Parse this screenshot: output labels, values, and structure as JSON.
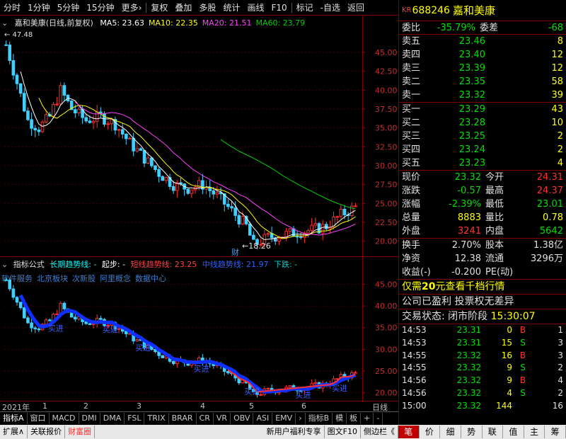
{
  "toolbar": {
    "items": [
      "分时",
      "1分钟",
      "5分钟",
      "15分钟",
      "更多›",
      "复权",
      "叠加",
      "多股",
      "统计",
      "画线",
      "F10",
      "标记",
      "-自选",
      "返回"
    ]
  },
  "main_chart": {
    "stock_label": "嘉和美康(日线,前复权)",
    "ma": [
      {
        "label": "MA5: 23.63",
        "color": "#ffffff"
      },
      {
        "label": "MA10: 22.35",
        "color": "#ffff00"
      },
      {
        "label": "MA20: 21.51",
        "color": "#ff40ff"
      },
      {
        "label": "MA60: 23.79",
        "color": "#00d000"
      }
    ],
    "high_marker": "47.48",
    "low_marker": "18.26",
    "event_marker": "财",
    "price_ticks": [
      "45.00",
      "42.50",
      "40.00",
      "37.50",
      "35.00",
      "32.50",
      "30.00",
      "27.50",
      "25.00",
      "22.50",
      "20.00"
    ],
    "price_range": [
      18.0,
      48.0
    ]
  },
  "sub_chart": {
    "formula_label": "指标公式",
    "long_trend": "长期趋势线: -",
    "start_label": "起步: -",
    "short_trend": "短线趋势线: 23.25",
    "mid_trend": "中线趋势线: 21.97",
    "down_label": "下跌: -",
    "concepts": [
      "软件服务",
      "北京板块",
      "次新股",
      "阿里概念",
      "数据中心"
    ],
    "buy_signal": "买进",
    "price_ticks": [
      "45.00",
      "40.00",
      "35.00",
      "30.00",
      "25.00",
      "20.00"
    ],
    "price_range": [
      18.0,
      48.0
    ]
  },
  "date_axis": {
    "labels": [
      "2021年",
      "1",
      "2",
      "3",
      "4",
      "5",
      "6"
    ],
    "period_label": "日线"
  },
  "indicator_tabs": [
    "指标A",
    "窗口",
    "MACD",
    "DMI",
    "DMA",
    "FSL",
    "TRIX",
    "BRAR",
    "CR",
    "VR",
    "OBV",
    "ASI",
    "EMV",
    "›",
    "指标B",
    "模",
    "板",
    "+",
    "-"
  ],
  "status_bar": {
    "left": [
      "扩展∧",
      "关联报价",
      "财富圈"
    ],
    "right": [
      "新用户福利专享",
      "图文F10",
      "侧边栏《"
    ]
  },
  "quote": {
    "kr": "KR",
    "code": "688246",
    "name": "嘉和美康",
    "weibi_label": "委比",
    "weibi": "-35.79%",
    "weicha_label": "委差",
    "weicha": "-68",
    "sells": [
      {
        "label": "卖五",
        "price": "23.46",
        "vol": "8"
      },
      {
        "label": "卖四",
        "price": "23.40",
        "vol": "12"
      },
      {
        "label": "卖三",
        "price": "23.39",
        "vol": "12"
      },
      {
        "label": "卖二",
        "price": "23.35",
        "vol": "58"
      },
      {
        "label": "卖一",
        "price": "23.32",
        "vol": "39"
      }
    ],
    "buys": [
      {
        "label": "买一",
        "price": "23.29",
        "vol": "43"
      },
      {
        "label": "买二",
        "price": "23.28",
        "vol": "10"
      },
      {
        "label": "买三",
        "price": "23.25",
        "vol": "2"
      },
      {
        "label": "买四",
        "price": "23.24",
        "vol": "2"
      },
      {
        "label": "买五",
        "price": "23.23",
        "vol": "4"
      }
    ],
    "stats": [
      {
        "l1": "现价",
        "v1": "23.32",
        "c1": "green",
        "l2": "今开",
        "v2": "24.31",
        "c2": "red"
      },
      {
        "l1": "涨跌",
        "v1": "-0.57",
        "c1": "green",
        "l2": "最高",
        "v2": "24.37",
        "c2": "red"
      },
      {
        "l1": "涨幅",
        "v1": "-2.39%",
        "c1": "green",
        "l2": "最低",
        "v2": "23.01",
        "c2": "green"
      },
      {
        "l1": "总量",
        "v1": "8883",
        "c1": "yellow",
        "l2": "量比",
        "v2": "0.78",
        "c2": "yellow"
      },
      {
        "l1": "外盘",
        "v1": "3241",
        "c1": "red",
        "l2": "内盘",
        "v2": "5642",
        "c2": "green"
      }
    ],
    "stats2": [
      {
        "l1": "换手",
        "v1": "2.70%",
        "c1": "white",
        "l2": "股本",
        "v2": "1.38亿",
        "c2": "white"
      },
      {
        "l1": "净资",
        "v1": "12.38",
        "c1": "white",
        "l2": "流通",
        "v2": "3296万",
        "c2": "white"
      },
      {
        "l1": "收益(-)",
        "v1": "-0.200",
        "c1": "white",
        "l2": "PE(动)",
        "v2": "",
        "c2": "white"
      }
    ],
    "promo_pre": "仅需",
    "promo_num": "20",
    "promo_post": "元查看千档行情",
    "info": "公司已盈利 投票权无差异",
    "trade_status_label": "交易状态: 闭市阶段",
    "trade_status_time": "15:30:07",
    "ticks": [
      {
        "t": "14:53",
        "p": "23.31",
        "v": "0",
        "bs": "B",
        "bsc": "red",
        "n": "1"
      },
      {
        "t": "14:53",
        "p": "23.31",
        "v": "15",
        "bs": "S",
        "bsc": "green",
        "n": "3"
      },
      {
        "t": "14:55",
        "p": "23.32",
        "v": "16",
        "bs": "B",
        "bsc": "red",
        "n": "3"
      },
      {
        "t": "14:55",
        "p": "23.32",
        "v": "9",
        "bs": "S",
        "bsc": "green",
        "n": "2"
      },
      {
        "t": "14:56",
        "p": "23.32",
        "v": "9",
        "bs": "B",
        "bsc": "red",
        "n": "4"
      },
      {
        "t": "14:56",
        "p": "23.32",
        "v": "4",
        "bs": "S",
        "bsc": "green",
        "n": "2"
      },
      {
        "t": "15:00",
        "p": "23.32",
        "v": "144",
        "bs": "",
        "bsc": "",
        "n": "16"
      }
    ]
  },
  "panel_tabs": [
    "笔",
    "价",
    "细",
    "势",
    "联",
    "值",
    "主",
    "筹"
  ]
}
